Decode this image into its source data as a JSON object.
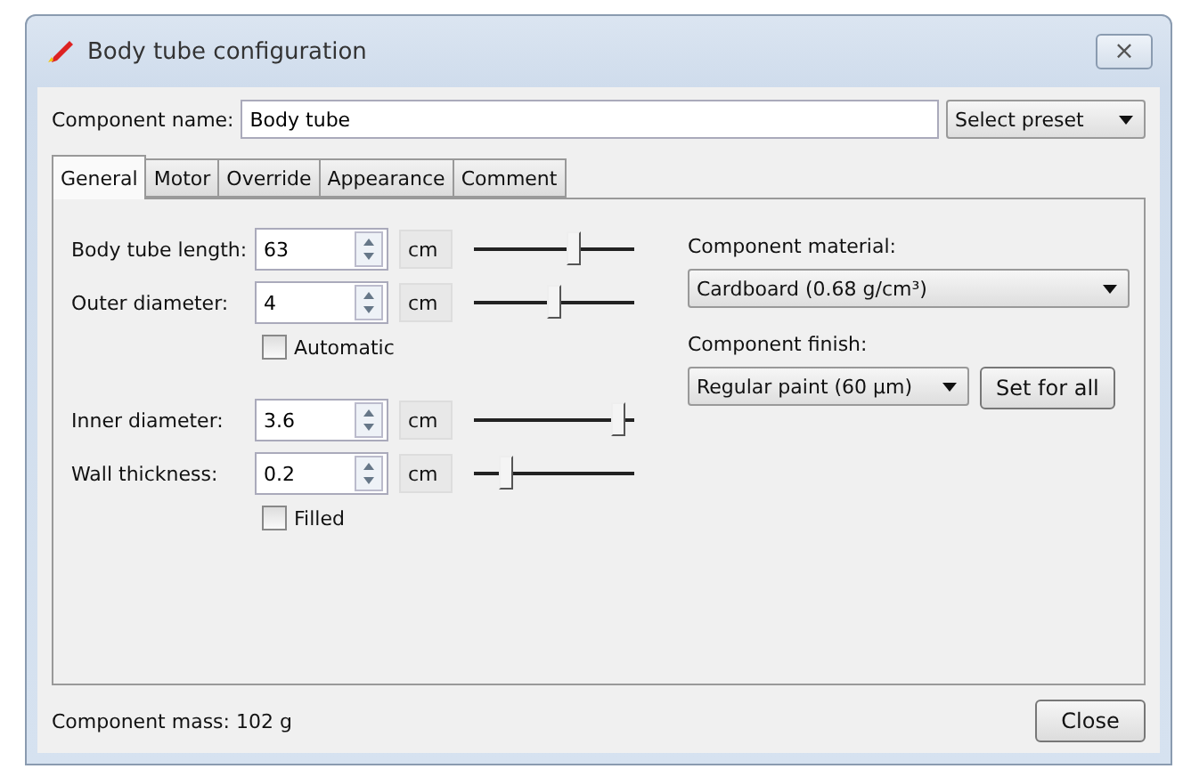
{
  "window": {
    "title": "Body tube configuration",
    "close": "×"
  },
  "component_name": {
    "label": "Component name:",
    "value": "Body tube"
  },
  "preset": {
    "label": "Select preset"
  },
  "tabs": [
    {
      "label": "General",
      "selected": true
    },
    {
      "label": "Motor",
      "selected": false
    },
    {
      "label": "Override",
      "selected": false
    },
    {
      "label": "Appearance",
      "selected": false
    },
    {
      "label": "Comment",
      "selected": false
    }
  ],
  "fields": [
    {
      "label": "Body tube length:",
      "value": "63",
      "unit": "cm",
      "level": 0.63
    },
    {
      "label": "Outer diameter:",
      "value": "4",
      "unit": "cm",
      "level": 0.5,
      "checkbox": {
        "label": "Automatic",
        "checked": false
      }
    },
    {
      "label": "Inner diameter:",
      "value": "3.6",
      "unit": "cm",
      "level": 0.94
    },
    {
      "label": "Wall thickness:",
      "value": "0.2",
      "unit": "cm",
      "level": 0.17,
      "checkbox": {
        "label": "Filled",
        "checked": false
      }
    }
  ],
  "material": {
    "label": "Component material:",
    "value": "Cardboard (0.68 g/cm³)"
  },
  "finish": {
    "label": "Component finish:",
    "value": "Regular paint (60 µm)",
    "button": "Set for all"
  },
  "mass": "Component mass: 102 g",
  "close_button": "Close"
}
